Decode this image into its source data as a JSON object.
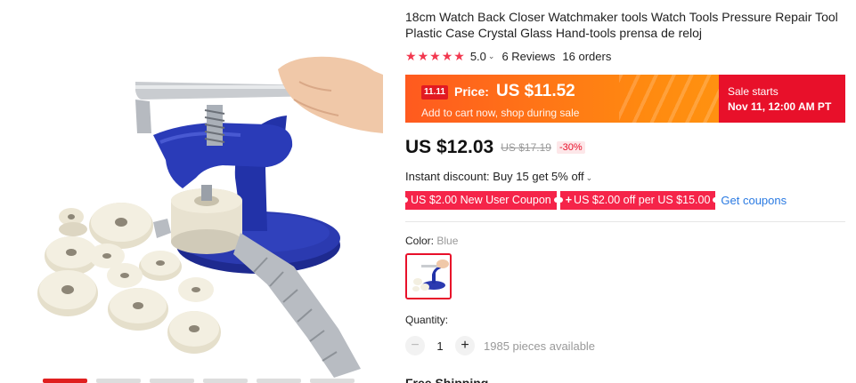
{
  "product": {
    "title": "18cm Watch Back Closer Watchmaker tools Watch Tools Pressure Repair Tool Plastic Case Crystal Glass Hand-tools prensa de reloj",
    "rating": {
      "stars": 5,
      "score": "5.0",
      "reviews": "6 Reviews",
      "orders": "16 orders"
    }
  },
  "promo": {
    "badge": "11.11",
    "price_label": "Price:",
    "price": "US $11.52",
    "subtitle": "Add to cart now, shop during sale",
    "sale_title": "Sale starts",
    "sale_time": "Nov 11, 12:00 AM PT"
  },
  "pricing": {
    "price": "US $12.03",
    "old_price": "US $17.19",
    "discount": "-30%"
  },
  "instant_discount": "Instant discount: Buy 15 get 5% off",
  "coupons": {
    "new_user": "US $2.00 New User Coupon",
    "per_order": "US $2.00 off per US $15.00",
    "get_link": "Get coupons"
  },
  "color": {
    "label": "Color:",
    "value": "Blue"
  },
  "quantity": {
    "label": "Quantity:",
    "value": "1",
    "available": "1985 pieces available"
  },
  "shipping": {
    "label": "Free Shipping"
  },
  "colors": {
    "accent_red": "#e8102a",
    "coupon_red": "#f52449",
    "promo_orange": "#ff8a10",
    "link_blue": "#2a7ae2",
    "tool_blue": "#2433a0"
  },
  "icons": {
    "star": "star-icon",
    "caret": "chevron-down-icon",
    "minus": "minus-icon",
    "plus": "plus-icon"
  }
}
